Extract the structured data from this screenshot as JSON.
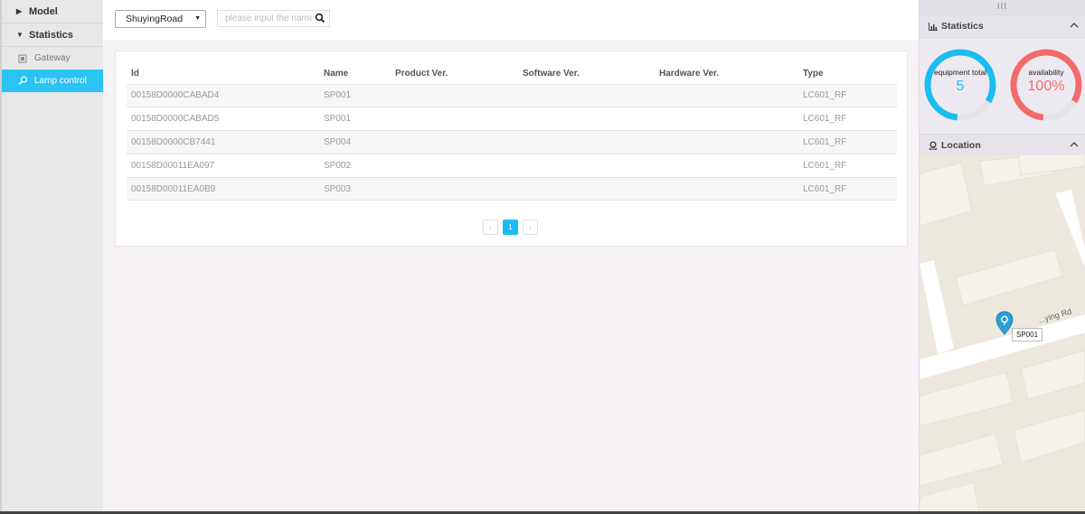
{
  "sidebar": {
    "groups": [
      {
        "label": "Model",
        "expanded": false
      },
      {
        "label": "Statistics",
        "expanded": true
      }
    ],
    "items": [
      {
        "label": "Gateway",
        "icon": "chip-icon",
        "active": false
      },
      {
        "label": "Lamp control",
        "icon": "lamp-icon",
        "active": true
      }
    ]
  },
  "toolbar": {
    "road_select": "ShuyingRoad",
    "search_placeholder": "please input the name",
    "search_value": ""
  },
  "table": {
    "columns": [
      "Id",
      "Name",
      "Product Ver.",
      "Software Ver.",
      "Hardware Ver.",
      "Type"
    ],
    "rows": [
      {
        "id": "00158D0000CABAD4",
        "name": "SP001",
        "product": "",
        "software": "",
        "hardware": "",
        "type": "LC601_RF"
      },
      {
        "id": "00158D0000CABAD5",
        "name": "SP001",
        "product": "",
        "software": "",
        "hardware": "",
        "type": "LC601_RF"
      },
      {
        "id": "00158D0000CB7441",
        "name": "SP004",
        "product": "",
        "software": "",
        "hardware": "",
        "type": "LC601_RF"
      },
      {
        "id": "00158D00011EA097",
        "name": "SP002",
        "product": "",
        "software": "",
        "hardware": "",
        "type": "LC601_RF"
      },
      {
        "id": "00158D00011EA0B9",
        "name": "SP003",
        "product": "",
        "software": "",
        "hardware": "",
        "type": "LC601_RF"
      }
    ]
  },
  "pager": {
    "prev": "‹",
    "current": "1",
    "next": "›"
  },
  "right_panel": {
    "grip": "III",
    "statistics": {
      "title": "Statistics",
      "equipment_label": "equipment total",
      "equipment_value": "5",
      "availability_label": "availability",
      "availability_value": "100%",
      "equipment_fraction": 0.82,
      "availability_fraction": 0.82,
      "equipment_color": "#1cbdf0",
      "availability_color": "#f26b6b"
    },
    "location": {
      "title": "Location",
      "marker_label": "SP001",
      "road_label": "...ying Rd"
    }
  }
}
